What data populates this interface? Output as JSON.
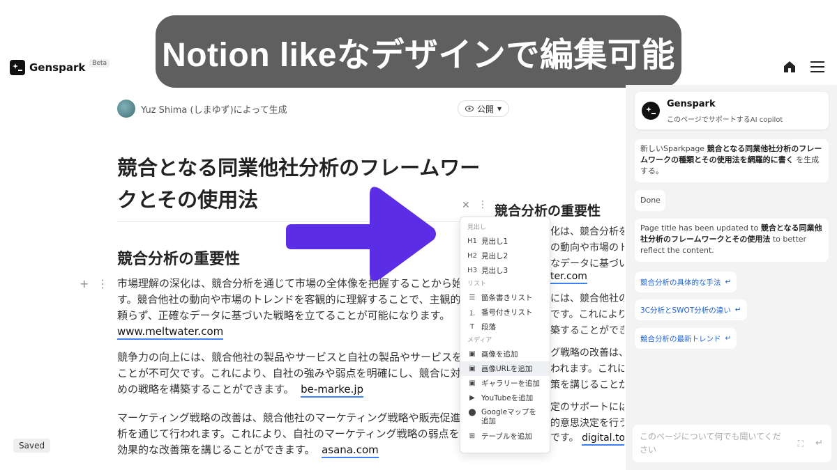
{
  "banner": {
    "text": "Notion likeなデザインで編集可能"
  },
  "header": {
    "brand": "Genspark",
    "beta": "Beta",
    "home_icon": "home-icon",
    "menu_icon": "hamburger-icon"
  },
  "doc": {
    "author": "Yuz Shima (しまゆず)によって生成",
    "visibility": "公開",
    "title_line1": "競合となる同業他社分析のフレームワー",
    "title_line2": "クとその使用法",
    "section_heading": "競合分析の重要性",
    "p1": {
      "l1": "市場理解の深化は、競合分析を通じて市場の全体像を把握することから始ま",
      "l2": "す。競合他社の動向や市場のトレンドを客観的に理解することで、主観的",
      "l3": "頼らず、正確なデータに基づいた戦略を立てることが可能になります。",
      "link": "www.meltwater.com"
    },
    "p2": {
      "l1": "競争力の向上には、競合他社の製品やサービスと自社の製品やサービスを比",
      "l2": "ことが不可欠です。これにより、自社の強みや弱点を明確にし、競合に対",
      "l3": "めの戦略を構築することができます。",
      "link": "be-marke.jp"
    },
    "p3": {
      "l1": "マーケティング戦略の改善は、競合他社のマーケティング戦略や販売促進",
      "l2": "析を通じて行われます。これにより、自社のマーケティング戦略の弱点を",
      "l3": "効果的な改善策を講じることができます。",
      "link": "asana.com"
    },
    "saved": "Saved"
  },
  "right_col": {
    "heading": "競合分析の重要性",
    "lines": [
      "化は、競合分析を",
      "の動向や市場のト",
      "なデータに基づい",
      "ter.com",
      "には、競合他社の",
      "です。これにより",
      "築することができ",
      "グ戦略の改善は、",
      "われます。これに",
      "策を講じることが",
      "定のサポートには",
      "的意思決定を行う",
      "です。"
    ],
    "link": "digital.to"
  },
  "dropdown": {
    "sec_headings": "見出し",
    "h1": "見出し1",
    "h2": "見出し2",
    "h3": "見出し3",
    "sec_list": "リスト",
    "bullet": "箇条書きリスト",
    "numbered": "番号付きリスト",
    "paragraph": "段落",
    "sec_media": "メディア",
    "add_image": "画像を追加",
    "add_image_url": "画像URLを追加",
    "add_gallery": "ギャラリーを追加",
    "add_youtube": "YouTubeを追加",
    "add_map": "Googleマップを追加",
    "add_table": "テーブルを追加"
  },
  "sidebar": {
    "title": "Genspark",
    "subtitle": "このページでサポートするAI copilot",
    "msg1_pre": "新しいSparkpage ",
    "msg1_bold": "競合となる同業他社分析のフレームワークの種類とその使用法を網羅的に書く",
    "msg1_post": " を生成する。",
    "msg2": "Done",
    "msg3_pre": "Page title has been updated to ",
    "msg3_bold": "競合となる同業他社分析のフレームワークとその使用法",
    "msg3_post": " to better reflect the content.",
    "suggestions": [
      "競合分析の具体的な手法",
      "3C分析とSWOT分析の違い",
      "競合分析の最新トレンド"
    ],
    "input_placeholder": "このページについて何でも聞いてください"
  },
  "colors": {
    "banner_bg": "#5f5f5f",
    "arrow": "#5b2ee6",
    "link_underline": "#3b82f6",
    "suggestion_text": "#1e63d6"
  }
}
